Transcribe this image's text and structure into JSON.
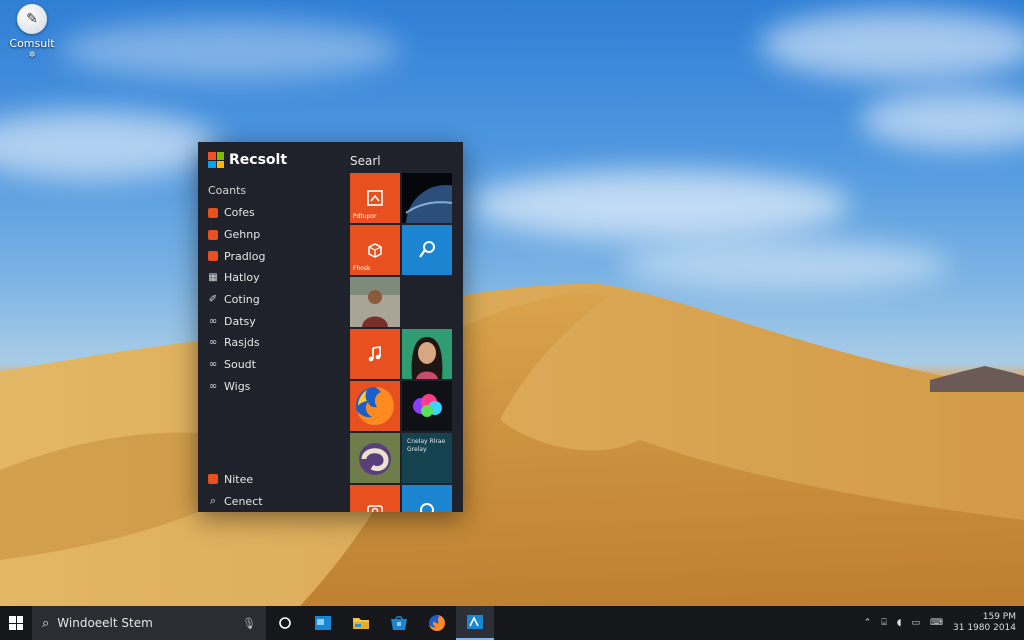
{
  "desktop_icon": {
    "label": "Comsult",
    "sublabel": "✲"
  },
  "start_menu": {
    "brand": "Recsolt",
    "search_label": "Searl",
    "heading": "Coants",
    "items": [
      {
        "label": "Cofes",
        "icon": "orange-square-icon"
      },
      {
        "label": "Gehnp",
        "icon": "orange-square-icon"
      },
      {
        "label": "Pradlog",
        "icon": "orange-square-icon"
      },
      {
        "label": "Hatloy",
        "icon": "grid-icon"
      },
      {
        "label": "Coting",
        "icon": "pen-icon"
      },
      {
        "label": "Datsy",
        "icon": "link-icon"
      },
      {
        "label": "Rasjds",
        "icon": "link-icon"
      },
      {
        "label": "Soudt",
        "icon": "link-icon"
      },
      {
        "label": "Wigs",
        "icon": "link-icon"
      }
    ],
    "bottom_items": [
      {
        "label": "Nitee",
        "icon": "orange-square-icon"
      },
      {
        "label": "Cenect",
        "icon": "search-icon"
      }
    ],
    "tiles": [
      {
        "type": "orange",
        "icon": "photo-frame-icon",
        "caption": "Pdtupor"
      },
      {
        "type": "dark",
        "icon": "earth-space-icon",
        "caption": ""
      },
      {
        "type": "orange",
        "icon": "box-icon",
        "caption": "Fhosk"
      },
      {
        "type": "blue",
        "icon": "key-p-icon",
        "caption": ""
      },
      {
        "type": "photo",
        "icon": "person-photo-icon",
        "caption": ""
      },
      {
        "type": "orange",
        "icon": "music-icon",
        "caption": ""
      },
      {
        "type": "photo",
        "icon": "woman-portrait-icon",
        "caption": ""
      },
      {
        "type": "orange",
        "icon": "firefox-icon",
        "caption": ""
      },
      {
        "type": "dark",
        "icon": "colorful-blob-icon",
        "caption": ""
      },
      {
        "type": "photo",
        "icon": "abstract-swirl-icon",
        "caption": ""
      },
      {
        "type": "teal",
        "icon": "text-tile-icon",
        "caption": "Cnelay Rlrae Grelay"
      },
      {
        "type": "orange",
        "icon": "camera-icon",
        "caption": ""
      },
      {
        "type": "blue",
        "icon": "circle-icon",
        "caption": ""
      }
    ]
  },
  "taskbar": {
    "search_text": "Windoeelt Stem",
    "clock_time": "159 PM",
    "clock_date": "31 1980 2014"
  },
  "colors": {
    "accent_orange": "#e8501f",
    "accent_blue": "#1b85d2",
    "menu_bg": "#20222b",
    "taskbar_bg": "#15171b"
  }
}
